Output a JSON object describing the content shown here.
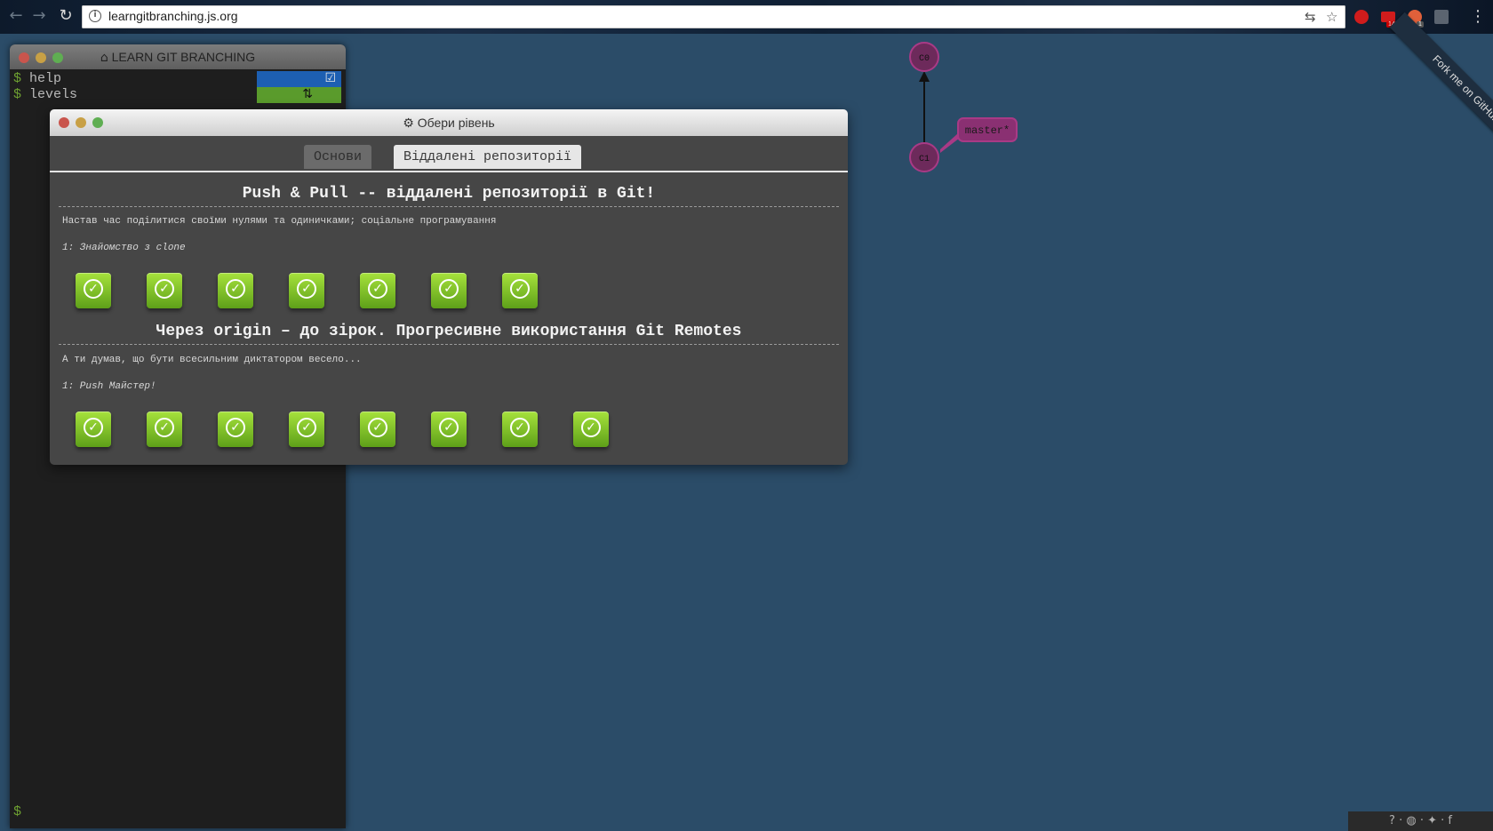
{
  "browser": {
    "url": "learngitbranching.js.org",
    "extensions": [
      {
        "name": "opera-icon",
        "color": "#d01c1c"
      },
      {
        "name": "mail-icon",
        "color": "#d01c1c",
        "badge": "145"
      },
      {
        "name": "extension-icon",
        "color": "#e0603a",
        "badge": "1"
      },
      {
        "name": "extension-gray-icon",
        "color": "#5b6470"
      }
    ]
  },
  "terminal": {
    "title": "LEARN GIT BRANCHING",
    "prompt": "$",
    "commands": [
      {
        "text": "help"
      },
      {
        "text": "levels"
      }
    ]
  },
  "modal": {
    "title": "Обери рівень",
    "tabs": [
      {
        "label": "Основи",
        "active": false
      },
      {
        "label": "Віддалені репозиторії",
        "active": true
      }
    ],
    "sequences": [
      {
        "title": "Push & Pull -- віддалені репозиторії в Git!",
        "description": "Настав час поділитися своїми нулями та одиничками; соціальне програмування",
        "level_label": "1: Знайомство з clone",
        "level_count": 7
      },
      {
        "title": "Через origin – до зірок. Прогресивне використання Git Remotes",
        "description": "А ти думав, що бути всесильним диктатором весело...",
        "level_label": "1: Push Майстер!",
        "level_count": 8
      }
    ]
  },
  "git_graph": {
    "commits": [
      "C0",
      "C1"
    ],
    "branch": "master*",
    "colors": {
      "commit": "#6d2a5b",
      "branch": "#a93a86",
      "background": "#2b4c68"
    }
  },
  "ribbon": "Fork me on GitHub",
  "footer": "? · ◍ · ✦ · f"
}
